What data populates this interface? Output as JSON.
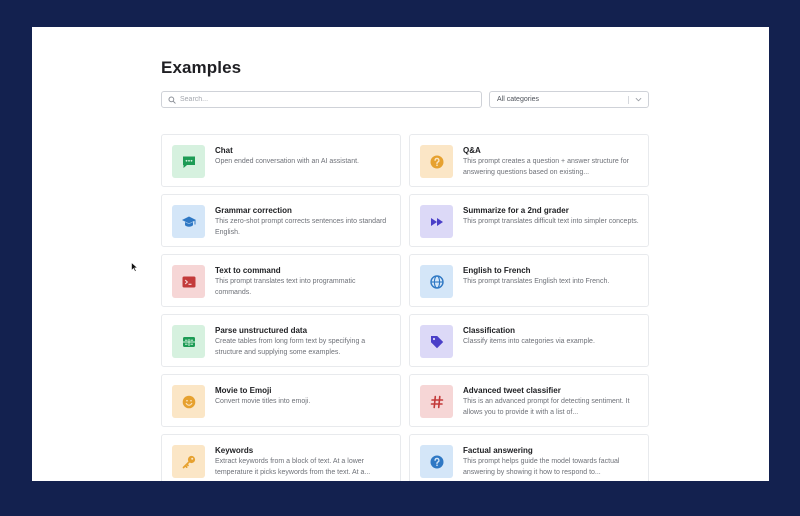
{
  "page": {
    "title": "Examples"
  },
  "search": {
    "placeholder": "Search...",
    "value": ""
  },
  "filter": {
    "selected": "All categories"
  },
  "colors": {
    "outer_background": "#13214f",
    "green_tile": "#d6f1df",
    "green_icon": "#1d9b55",
    "blue_tile": "#d4e6f8",
    "blue_icon": "#2f78c4",
    "orange_tile": "#fbe6c6",
    "orange_icon": "#e6a12f",
    "purple_tile": "#dcd9f7",
    "purple_icon": "#4a3fc8",
    "red_tile": "#f6d6d6",
    "red_icon": "#c33a3a"
  },
  "examples": [
    {
      "title": "Chat",
      "desc": "Open ended conversation with an AI assistant.",
      "icon": "chat-bubble-icon",
      "tile": "green"
    },
    {
      "title": "Q&A",
      "desc": "This prompt creates a question + answer structure for answering questions based on existing...",
      "icon": "question-icon",
      "tile": "orange"
    },
    {
      "title": "Grammar correction",
      "desc": "This zero-shot prompt corrects sentences into standard English.",
      "icon": "graduation-cap-icon",
      "tile": "blue"
    },
    {
      "title": "Summarize for a 2nd grader",
      "desc": "This prompt translates difficult text into simpler concepts.",
      "icon": "fast-forward-icon",
      "tile": "purple"
    },
    {
      "title": "Text to command",
      "desc": "This prompt translates text into programmatic commands.",
      "icon": "terminal-icon",
      "tile": "red"
    },
    {
      "title": "English to French",
      "desc": "This prompt translates English text into French.",
      "icon": "globe-icon",
      "tile": "blue"
    },
    {
      "title": "Parse unstructured data",
      "desc": "Create tables from long form text by specifying a structure and supplying some examples.",
      "icon": "table-icon",
      "tile": "green"
    },
    {
      "title": "Classification",
      "desc": "Classify items into categories via example.",
      "icon": "tag-icon",
      "tile": "purple"
    },
    {
      "title": "Movie to Emoji",
      "desc": "Convert movie titles into emoji.",
      "icon": "smiley-icon",
      "tile": "orange"
    },
    {
      "title": "Advanced tweet classifier",
      "desc": "This is an advanced prompt for detecting sentiment. It allows you to provide it with a list of...",
      "icon": "hashtag-icon",
      "tile": "red"
    },
    {
      "title": "Keywords",
      "desc": "Extract keywords from a block of text. At a lower temperature it picks keywords from the text. At a...",
      "icon": "key-icon",
      "tile": "orange"
    },
    {
      "title": "Factual answering",
      "desc": "This prompt helps guide the model towards factual answering by showing it how to respond to...",
      "icon": "question-icon",
      "tile": "blue"
    }
  ]
}
